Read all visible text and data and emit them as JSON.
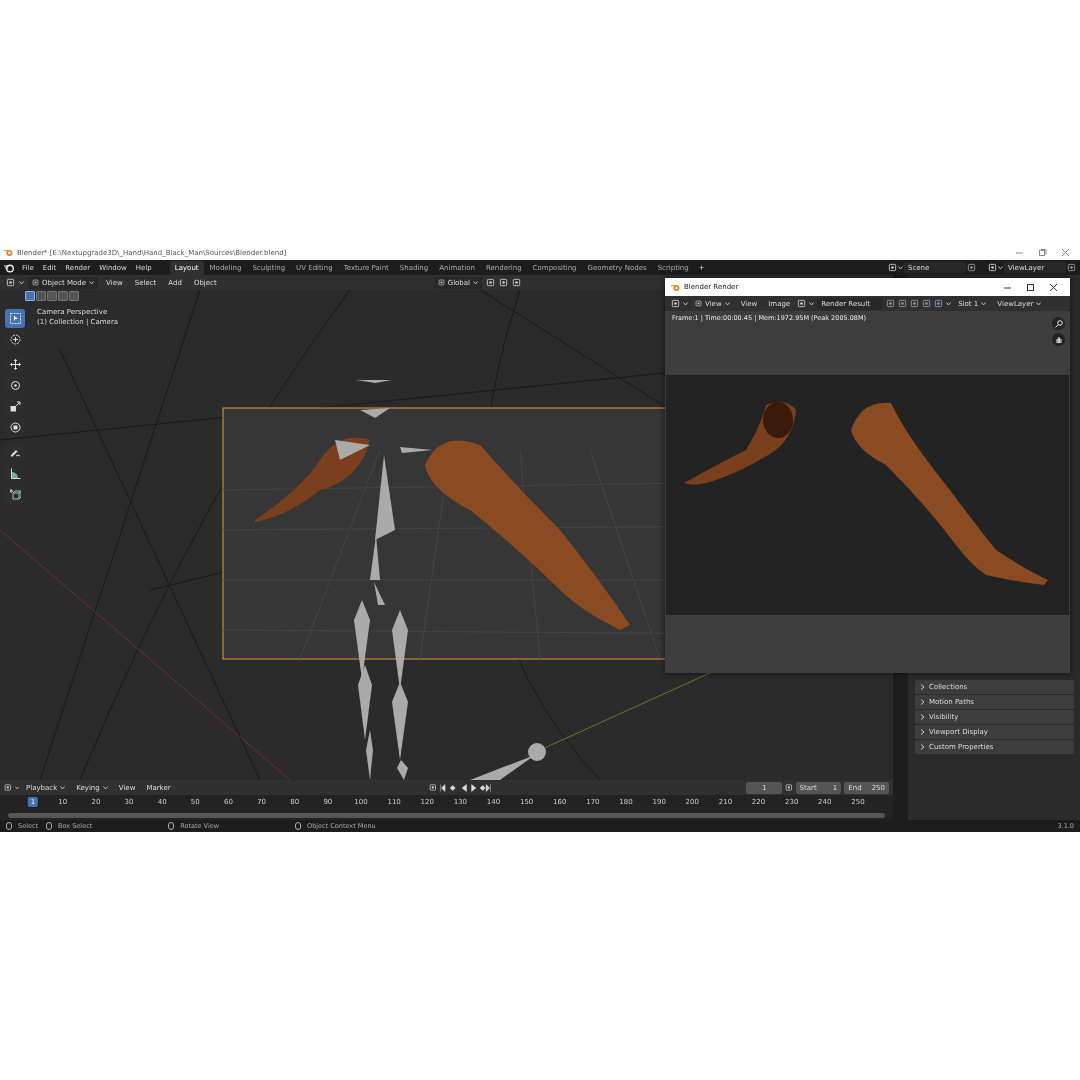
{
  "title_bar": {
    "title": "Blender* [E:\\Nextupgrade3D\\_Hand\\Hand_Black_Man\\Sources\\Blender.blend]"
  },
  "menu": [
    "File",
    "Edit",
    "Render",
    "Window",
    "Help"
  ],
  "workspaces": [
    {
      "label": "Layout",
      "selected": true
    },
    {
      "label": "Modeling",
      "selected": false
    },
    {
      "label": "Sculpting",
      "selected": false
    },
    {
      "label": "UV Editing",
      "selected": false
    },
    {
      "label": "Texture Paint",
      "selected": false
    },
    {
      "label": "Shading",
      "selected": false
    },
    {
      "label": "Animation",
      "selected": false
    },
    {
      "label": "Rendering",
      "selected": false
    },
    {
      "label": "Compositing",
      "selected": false
    },
    {
      "label": "Geometry Nodes",
      "selected": false
    },
    {
      "label": "Scripting",
      "selected": false
    }
  ],
  "add_workspace": "+",
  "scene": "Scene",
  "view_layer": "ViewLayer",
  "viewport": {
    "mode": "Object Mode",
    "menus": [
      "View",
      "Select",
      "Add",
      "Object"
    ],
    "orientation": "Global",
    "select_modes": [
      {
        "selected": true
      },
      {
        "selected": false
      },
      {
        "selected": false
      },
      {
        "selected": false
      },
      {
        "selected": false
      }
    ],
    "overlay_lines": [
      "Camera Perspective",
      "(1) Collection | Camera"
    ]
  },
  "tools": [
    {
      "kind": "select",
      "selected": true
    },
    {
      "kind": "cursor",
      "selected": false
    },
    {
      "kind": "move",
      "selected": false
    },
    {
      "kind": "rotate",
      "selected": false
    },
    {
      "kind": "scale",
      "selected": false
    },
    {
      "kind": "transform",
      "selected": false
    },
    {
      "kind": "annotate",
      "selected": false
    },
    {
      "kind": "measure",
      "selected": false
    },
    {
      "kind": "add-cube",
      "selected": false
    }
  ],
  "render_window": {
    "title": "Blender Render",
    "view_dropdown": "View",
    "menus": [
      "View",
      "Image"
    ],
    "image_name": "Render Result",
    "slot": "Slot 1",
    "view_layer": "ViewLayer",
    "stats": "Frame:1 | Time:00:00.45 | Mem:1972.95M (Peak 2005.08M)"
  },
  "properties": {
    "panels": [
      {
        "label": "Collections",
        "expanded": false
      },
      {
        "label": "Motion Paths",
        "expanded": false
      },
      {
        "label": "Visibility",
        "expanded": false
      },
      {
        "label": "Viewport Display",
        "expanded": false
      },
      {
        "label": "Custom Properties",
        "expanded": false
      }
    ]
  },
  "timeline": {
    "menus": [
      {
        "label": "Playback",
        "dropdown": true
      },
      {
        "label": "Keying",
        "dropdown": true
      },
      {
        "label": "View",
        "dropdown": false
      },
      {
        "label": "Marker",
        "dropdown": false
      }
    ],
    "current_frame": "1",
    "start_label": "Start",
    "start": "1",
    "end_label": "End",
    "end": "250",
    "ruler": [
      {
        "label": "1",
        "selected": true
      },
      {
        "label": "10",
        "selected": false
      },
      {
        "label": "20",
        "selected": false
      },
      {
        "label": "30",
        "selected": false
      },
      {
        "label": "40",
        "selected": false
      },
      {
        "label": "50",
        "selected": false
      },
      {
        "label": "60",
        "selected": false
      },
      {
        "label": "70",
        "selected": false
      },
      {
        "label": "80",
        "selected": false
      },
      {
        "label": "90",
        "selected": false
      },
      {
        "label": "100",
        "selected": false
      },
      {
        "label": "110",
        "selected": false
      },
      {
        "label": "120",
        "selected": false
      },
      {
        "label": "130",
        "selected": false
      },
      {
        "label": "140",
        "selected": false
      },
      {
        "label": "150",
        "selected": false
      },
      {
        "label": "160",
        "selected": false
      },
      {
        "label": "170",
        "selected": false
      },
      {
        "label": "180",
        "selected": false
      },
      {
        "label": "190",
        "selected": false
      },
      {
        "label": "200",
        "selected": false
      },
      {
        "label": "210",
        "selected": false
      },
      {
        "label": "220",
        "selected": false
      },
      {
        "label": "230",
        "selected": false
      },
      {
        "label": "240",
        "selected": false
      },
      {
        "label": "250",
        "selected": false
      }
    ]
  },
  "status_bar": {
    "hints": [
      "Select",
      "Box Select",
      "Rotate View",
      "Object Context Menu"
    ],
    "version": "3.1.0"
  }
}
